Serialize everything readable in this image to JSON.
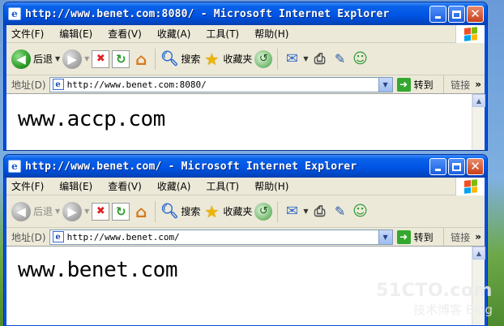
{
  "window_back": {
    "title": "http://www.benet.com:8080/ - Microsoft Internet Explorer",
    "menu": [
      "文件(F)",
      "编辑(E)",
      "查看(V)",
      "收藏(A)",
      "工具(T)",
      "帮助(H)"
    ],
    "toolbar": {
      "back": "后退",
      "search": "搜索",
      "favorites": "收藏夹"
    },
    "address": {
      "label": "地址(D)",
      "url": "http://www.benet.com:8080/",
      "go": "转到",
      "links": "链接"
    },
    "content_text": "www.accp.com"
  },
  "window_front": {
    "title": "http://www.benet.com/ - Microsoft Internet Explorer",
    "menu": [
      "文件(F)",
      "编辑(E)",
      "查看(V)",
      "收藏(A)",
      "工具(T)",
      "帮助(H)"
    ],
    "toolbar": {
      "back": "后退",
      "search": "搜索",
      "favorites": "收藏夹"
    },
    "address": {
      "label": "地址(D)",
      "url": "http://www.benet.com/",
      "go": "转到",
      "links": "链接"
    },
    "content_text": "www.benet.com"
  },
  "watermark": {
    "line1": "51CTO.com",
    "line2": "技术博客",
    "line3": "Blog"
  },
  "colors": {
    "title_bar": "#0055e5",
    "chrome": "#ece9d8",
    "go_green": "#32a82e"
  }
}
